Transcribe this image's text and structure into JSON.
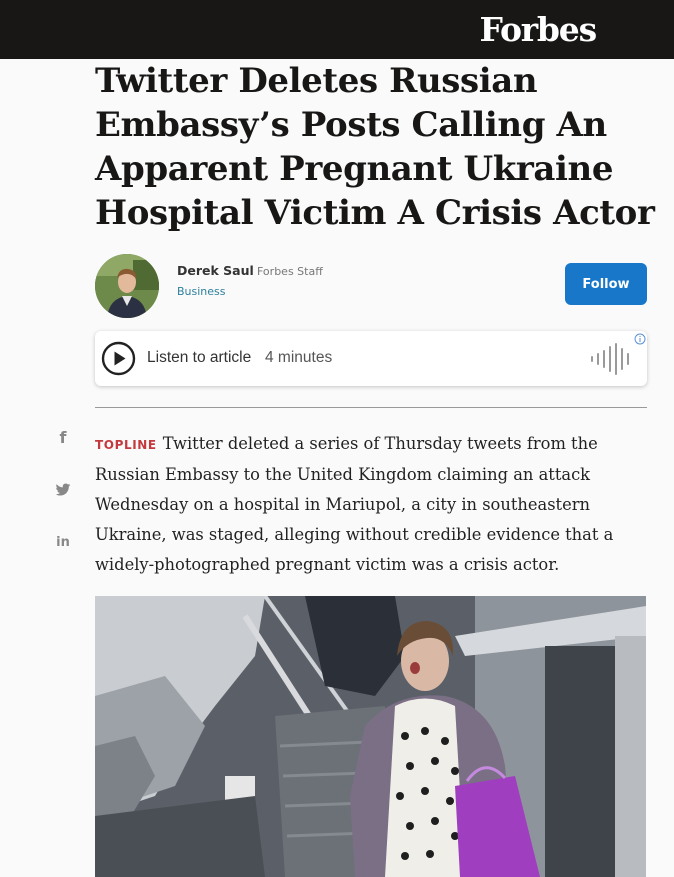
{
  "header": {
    "logo": "Forbes"
  },
  "article": {
    "headline": "Twitter Deletes Russian Embassy’s Posts Calling An Apparent Pregnant Ukraine Hospital Victim A Crisis Actor",
    "author": {
      "name": "Derek Saul",
      "role": "Forbes Staff",
      "section": "Business"
    },
    "follow_label": "Follow",
    "listen": {
      "label": "Listen to article",
      "duration": "4 minutes"
    },
    "topline_label": "TOPLINE",
    "topline_text": "Twitter deleted a series of Thursday tweets from the Russian Embassy to the United Kingdom claiming an attack Wednesday on a hospital in Mariupol, a city in southeastern Ukraine, was staged, alleging without credible evidence that a widely-photographed pregnant victim was a crisis actor."
  },
  "social": [
    {
      "icon": "facebook-icon",
      "glyph": "f"
    },
    {
      "icon": "twitter-icon",
      "glyph": "🐦"
    },
    {
      "icon": "linkedin-icon",
      "glyph": "in"
    }
  ],
  "colors": {
    "accent": "#1877c9",
    "topline": "#c4393e",
    "section": "#2d7f9c",
    "topbar": "#181716"
  }
}
